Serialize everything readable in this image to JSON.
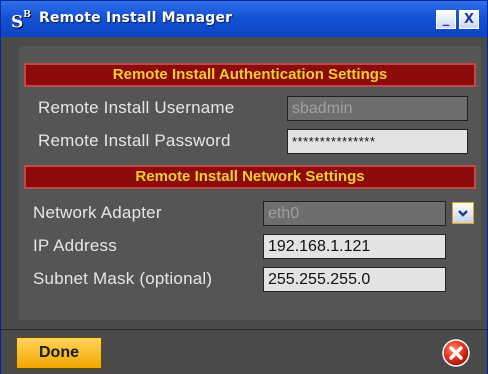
{
  "window": {
    "title": "Remote Install Manager",
    "app_icon_text": "S",
    "app_icon_sup": "B",
    "minimize_label": "_",
    "close_label": "X"
  },
  "auth": {
    "header": "Remote Install Authentication Settings",
    "username_label": "Remote Install Username",
    "username_value": "sbadmin",
    "password_label": "Remote Install Password",
    "password_value": "***************"
  },
  "network": {
    "header": "Remote Install Network Settings",
    "adapter_label": "Network Adapter",
    "adapter_value": "eth0",
    "ip_label": "IP Address",
    "ip_value": "192.168.1.121",
    "mask_label": "Subnet Mask (optional)",
    "mask_value": "255.255.255.0"
  },
  "actions": {
    "done_label": "Done"
  },
  "colors": {
    "header_bg": "#8e0b0b",
    "header_text": "#f2ce2f",
    "button_accent": "#f2a600",
    "cancel_red": "#e0301e"
  }
}
